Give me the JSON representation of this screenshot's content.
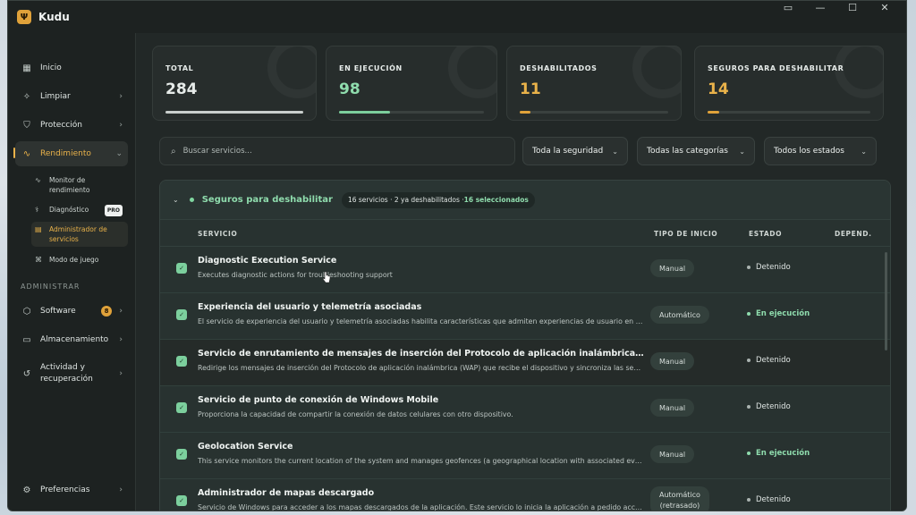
{
  "app": {
    "title": "Kudu",
    "logo": "antlers-icon"
  },
  "window_controls": [
    "▭",
    "—",
    "☐",
    "✕"
  ],
  "sidebar": {
    "items": [
      {
        "label": "Inicio",
        "icon": "grid-icon",
        "chevron": ""
      },
      {
        "label": "Limpiar",
        "icon": "sparkle-icon",
        "chevron": "›"
      },
      {
        "label": "Protección",
        "icon": "shield-icon",
        "chevron": "›"
      },
      {
        "label": "Rendimiento",
        "icon": "pulse-icon",
        "chevron": "⌄"
      }
    ],
    "subitems": [
      {
        "label": "Monitor de rendimiento",
        "icon": "pulse-icon"
      },
      {
        "label": "Diagnóstico",
        "icon": "stethoscope-icon",
        "badge": "PRO"
      },
      {
        "label": "Administrador de servicios",
        "icon": "server-icon"
      },
      {
        "label": "Modo de juego",
        "icon": "gamepad-icon"
      }
    ],
    "section_label": "ADMINISTRAR",
    "admin_items": [
      {
        "label": "Software",
        "icon": "package-icon",
        "badge": "8",
        "chevron": "›"
      },
      {
        "label": "Almacenamiento",
        "icon": "storage-icon",
        "chevron": "›"
      },
      {
        "label": "Actividad y recuperación",
        "icon": "history-icon",
        "chevron": "›"
      }
    ],
    "footer": {
      "label": "Preferencias",
      "icon": "gear-icon",
      "chevron": "›"
    }
  },
  "stats": [
    {
      "label": "TOTAL",
      "value": "284",
      "progress": 1.0,
      "color": "#e6ebe9",
      "fill": "#c9cfcd"
    },
    {
      "label": "EN EJECUCIÓN",
      "value": "98",
      "progress": 0.35,
      "color": "#8fdcad",
      "fill": "#7ccf9d"
    },
    {
      "label": "DESHABILITADOS",
      "value": "11",
      "progress": 0.07,
      "color": "#e9b24a",
      "fill": "#e0a23a"
    },
    {
      "label": "SEGUROS PARA DESHABILITAR",
      "value": "14",
      "progress": 0.07,
      "color": "#e9b24a",
      "fill": "#e0a23a"
    }
  ],
  "filters": {
    "search_placeholder": "Buscar servicios...",
    "security": "Toda la seguridad",
    "category": "Todas las categorías",
    "state": "Todos los estados"
  },
  "group": {
    "title": "Seguros para deshabilitar",
    "summary": "16 servicios · 2 ya deshabilitados · ",
    "selected": "16 seleccionados"
  },
  "columns": {
    "service": "SERVICIO",
    "start_type": "TIPO DE INICIO",
    "state": "ESTADO",
    "depend": "DEPEND."
  },
  "rows": [
    {
      "name": "Diagnostic Execution Service",
      "desc": "Executes diagnostic actions for troubleshooting support",
      "type": "Manual",
      "state": "Detenido",
      "running": false
    },
    {
      "name": "Experiencia del usuario y telemetría asociadas",
      "desc": "El servicio de experiencia del usuario y telemetría asociadas habilita características que admiten experiencias de usuario en la aplicación",
      "type": "Automático",
      "state": "En ejecución",
      "running": true
    },
    {
      "name": "Servicio de enrutamiento de mensajes de inserción del Protocolo de aplicación inalámbrica (WAP) de administración",
      "desc": "Redirige los mensajes de inserción del Protocolo de aplicación inalámbrica (WAP) que recibe el dispositivo y sincroniza las sesiones",
      "type": "Manual",
      "state": "Detenido",
      "running": false
    },
    {
      "name": "Servicio de punto de conexión de Windows Mobile",
      "desc": "Proporciona la capacidad de compartir la conexión de datos celulares con otro dispositivo.",
      "type": "Manual",
      "state": "Detenido",
      "running": false
    },
    {
      "name": "Geolocation Service",
      "desc": "This service monitors the current location of the system and manages geofences (a geographical location with associated events)",
      "type": "Manual",
      "state": "En ejecución",
      "running": true
    },
    {
      "name": "Administrador de mapas descargado",
      "desc": "Servicio de Windows para acceder a los mapas descargados de la aplicación. Este servicio lo inicia la aplicación a pedido acceder",
      "type": "Automático",
      "type2": "(retrasado)",
      "state": "Detenido",
      "running": false
    }
  ]
}
